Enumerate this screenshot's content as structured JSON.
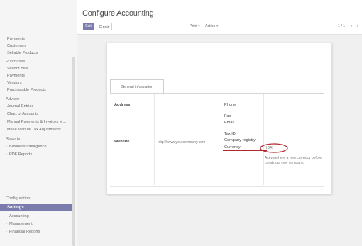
{
  "sidebar": {
    "items": [
      {
        "label": "Payments"
      },
      {
        "label": "Customers"
      },
      {
        "label": "Sellable Products"
      },
      {
        "label": "Purchases",
        "heading": true
      },
      {
        "label": "Vendor Bills"
      },
      {
        "label": "Payments"
      },
      {
        "label": "Vendors"
      },
      {
        "label": "Purchasable Products"
      },
      {
        "label": "Adviser",
        "heading": true
      },
      {
        "label": "Journal Entries"
      },
      {
        "label": "Chart of Accounts"
      },
      {
        "label": "Manual Payments & Invoices M..."
      },
      {
        "label": "Make Manual Tax Adjustments"
      },
      {
        "label": "Reports",
        "heading": true
      },
      {
        "label": "Business Intelligence"
      },
      {
        "label": "PDF Reports"
      },
      {
        "label": "Configuration",
        "heading": true
      },
      {
        "label": "Settings"
      },
      {
        "label": "Accounting"
      },
      {
        "label": "Management"
      },
      {
        "label": "Financial Reports"
      }
    ],
    "active": "Settings"
  },
  "header": {
    "title": "Configure Accounting",
    "edit_label": "Edit",
    "create_label": "Create",
    "print_label": "Print ▾",
    "action_label": "Action ▾",
    "pager": "1 / 1",
    "prev": "‹",
    "next": "›"
  },
  "form": {
    "tab_label": "General information",
    "address_label": "Address",
    "website_label": "Website",
    "website_value": "http://www.yourcompany.com",
    "phone_label": "Phone",
    "fax_label": "Fax",
    "email_label": "Email",
    "tax_id_label": "Tax ID",
    "company_registry_label": "Company registry",
    "currency_label": "Currency",
    "currency_value": "IDR",
    "currency_hint": "Activate here a new currency before creating a new company."
  },
  "colors": {
    "accent": "#7c7bad",
    "annotation": "#b5262d"
  }
}
